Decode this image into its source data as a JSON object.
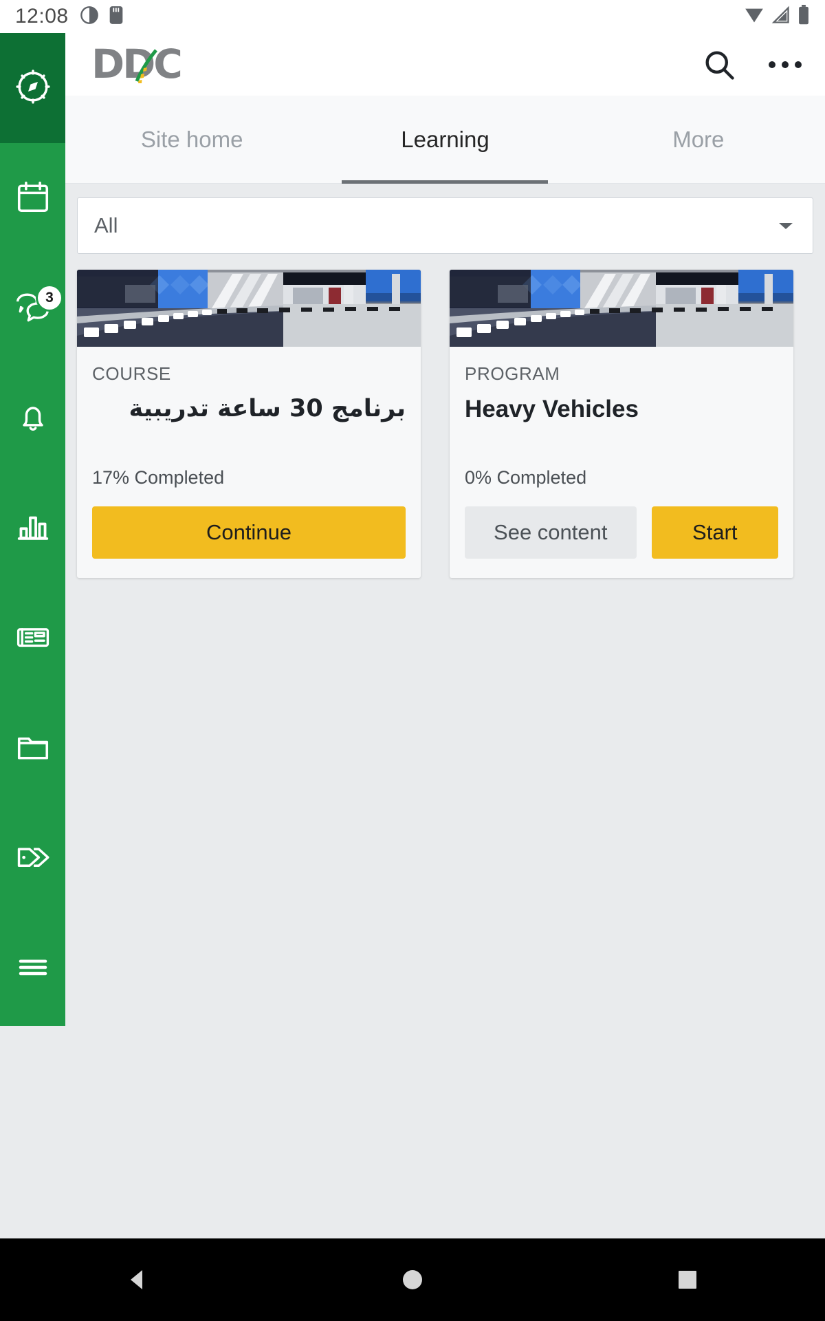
{
  "statusbar": {
    "time": "12:08",
    "left_icons": [
      "screenshot-icon",
      "sd-card-icon"
    ],
    "right_icons": [
      "wifi-icon",
      "cellular-signal-icon",
      "battery-icon"
    ]
  },
  "sidebar": {
    "background_color": "#1f9a48",
    "active_background_color": "#0d7034",
    "items": [
      {
        "name": "compass",
        "icon": "compass-icon",
        "active": true,
        "badge": ""
      },
      {
        "name": "calendar",
        "icon": "calendar-icon",
        "active": false,
        "badge": ""
      },
      {
        "name": "messages",
        "icon": "chat-bubbles-icon",
        "active": false,
        "badge": "3"
      },
      {
        "name": "notifications",
        "icon": "bell-icon",
        "active": false,
        "badge": ""
      },
      {
        "name": "reports",
        "icon": "bar-chart-icon",
        "active": false,
        "badge": ""
      },
      {
        "name": "news",
        "icon": "newspaper-icon",
        "active": false,
        "badge": ""
      },
      {
        "name": "files",
        "icon": "folder-icon",
        "active": false,
        "badge": ""
      },
      {
        "name": "tags",
        "icon": "tags-icon",
        "active": false,
        "badge": ""
      },
      {
        "name": "menu",
        "icon": "hamburger-menu-icon",
        "active": false,
        "badge": ""
      }
    ]
  },
  "header": {
    "logo_text": "DDC",
    "logo_color": "#808285",
    "logo_accent_yellow": "#f2bc1f",
    "logo_accent_green": "#1f9a48",
    "search_icon": "search-icon",
    "overflow_icon": "more-options-icon"
  },
  "tabs": {
    "items": [
      {
        "label": "Site home",
        "active": false
      },
      {
        "label": "Learning",
        "active": true
      },
      {
        "label": "More",
        "active": false
      }
    ]
  },
  "filter": {
    "value": "All",
    "placeholder": "All",
    "caret_icon": "chevron-down-icon"
  },
  "cards": [
    {
      "kicker": "COURSE",
      "title": "برنامج 30 ساعة تدريبية",
      "rtl": true,
      "progress": "17% Completed",
      "buttons": [
        {
          "label": "Continue",
          "style": "primary"
        }
      ]
    },
    {
      "kicker": "PROGRAM",
      "title": "Heavy Vehicles",
      "rtl": false,
      "progress": "0% Completed",
      "buttons": [
        {
          "label": "See content",
          "style": "secondary"
        },
        {
          "label": "Start",
          "style": "start"
        }
      ]
    }
  ],
  "navbar": {
    "buttons": [
      {
        "name": "back-button",
        "icon": "triangle-back-icon"
      },
      {
        "name": "home-button",
        "icon": "circle-home-icon"
      },
      {
        "name": "recents-button",
        "icon": "square-recents-icon"
      }
    ]
  }
}
